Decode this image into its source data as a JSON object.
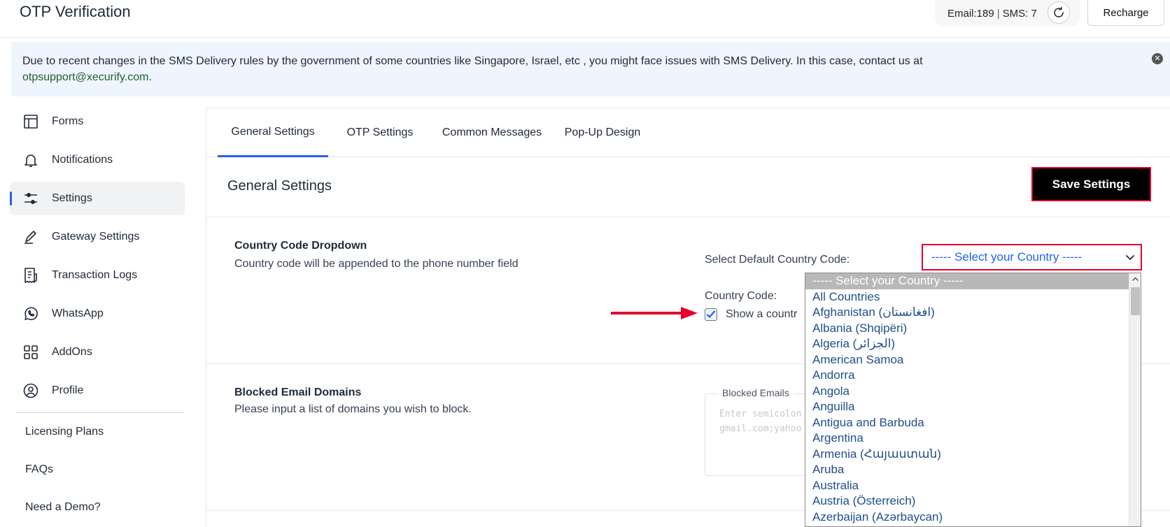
{
  "app": {
    "title": "OTP Verification"
  },
  "credits": {
    "email": "Email:189",
    "sep": "|",
    "sms": "SMS: 7",
    "refresh_icon": "refresh-icon"
  },
  "header": {
    "recharge_label": "Recharge"
  },
  "notice": {
    "text": "Due to recent changes in the SMS Delivery rules by the government of some countries like Singapore, Israel, etc , you might face issues with SMS Delivery. In this case, contact us at",
    "email": "otpsupport@xecurify.com",
    "tail": ".",
    "close_icon": "close-icon"
  },
  "sidebar": {
    "items": [
      {
        "label": "Forms",
        "icon": "layout-icon",
        "active": false
      },
      {
        "label": "Notifications",
        "icon": "bell-icon",
        "active": false
      },
      {
        "label": "Settings",
        "icon": "sliders-icon",
        "active": true
      },
      {
        "label": "Gateway Settings",
        "icon": "pen-icon",
        "active": false
      },
      {
        "label": "Transaction Logs",
        "icon": "receipt-icon",
        "active": false
      },
      {
        "label": "WhatsApp",
        "icon": "whatsapp-icon",
        "active": false
      },
      {
        "label": "AddOns",
        "icon": "grid-icon",
        "active": false
      },
      {
        "label": "Profile",
        "icon": "user-circle-icon",
        "active": false
      }
    ],
    "secondary": [
      "Licensing Plans",
      "FAQs",
      "Need a Demo?"
    ]
  },
  "tabs": [
    "General Settings",
    "OTP Settings",
    "Common Messages",
    "Pop-Up Design"
  ],
  "active_tab": "General Settings",
  "main": {
    "section_title": "General Settings",
    "save_label": "Save Settings",
    "country_code": {
      "title": "Country Code Dropdown",
      "desc": "Country code will be appended to the phone number field",
      "default_label": "Select Default Country Code:",
      "select_value": "----- Select your Country -----",
      "code_label": "Country Code:",
      "checkbox_label": "Show a countr",
      "checkbox_checked": true
    },
    "blocked": {
      "title": "Blocked Email Domains",
      "desc": "Please input a list of domains you wish to block.",
      "legend": "Blocked Emails",
      "placeholder": "Enter semicolon\ngmail.com;yahoo"
    }
  },
  "dropdown": {
    "options": [
      "----- Select your Country -----",
      "All Countries",
      "Afghanistan (‫افغانستان‬‎)",
      "Albania (Shqipëri)",
      "Algeria (‫الجزائر‬‎)",
      "American Samoa",
      "Andorra",
      "Angola",
      "Anguilla",
      "Antigua and Barbuda",
      "Argentina",
      "Armenia (Հայաստան)",
      "Aruba",
      "Australia",
      "Austria (Österreich)",
      "Azerbaijan (Azərbaycan)"
    ],
    "selected_index": 0
  },
  "colors": {
    "accent": "#2563eb",
    "highlight": "#e4002b",
    "notice_bg": "#eef5ff",
    "link": "#1f5f2b"
  }
}
